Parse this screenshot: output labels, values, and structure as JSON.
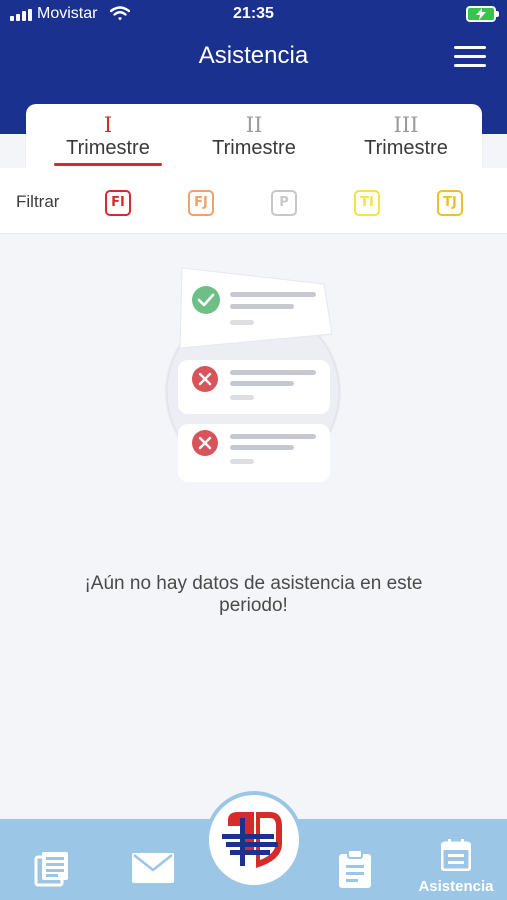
{
  "status_bar": {
    "carrier": "Movistar",
    "time": "21:35"
  },
  "header": {
    "title": "Asistencia"
  },
  "tabs": [
    {
      "numeral": "I",
      "label": "Trimestre",
      "active": true
    },
    {
      "numeral": "II",
      "label": "Trimestre",
      "active": false
    },
    {
      "numeral": "III",
      "label": "Trimestre",
      "active": false
    }
  ],
  "filters": {
    "label": "Filtrar",
    "chips": [
      {
        "code": "FI",
        "color": "#d62b2b"
      },
      {
        "code": "FJ",
        "color": "#f0a06a"
      },
      {
        "code": "P",
        "color": "#c8c8c8"
      },
      {
        "code": "TI",
        "color": "#f3e24a"
      },
      {
        "code": "TJ",
        "color": "#e8c030"
      }
    ]
  },
  "empty_state": {
    "message": "¡Aún no hay datos de asistencia en este periodo!"
  },
  "bottom_nav": {
    "items": [
      {
        "icon": "news-icon"
      },
      {
        "icon": "mail-icon"
      },
      {
        "icon": "school-logo-icon"
      },
      {
        "icon": "clipboard-icon"
      },
      {
        "icon": "calendar-icon",
        "label": "Asistencia",
        "active": true
      }
    ]
  },
  "colors": {
    "header": "#1b3190",
    "accent": "#d62b2b",
    "nav": "#9cc6e6"
  }
}
